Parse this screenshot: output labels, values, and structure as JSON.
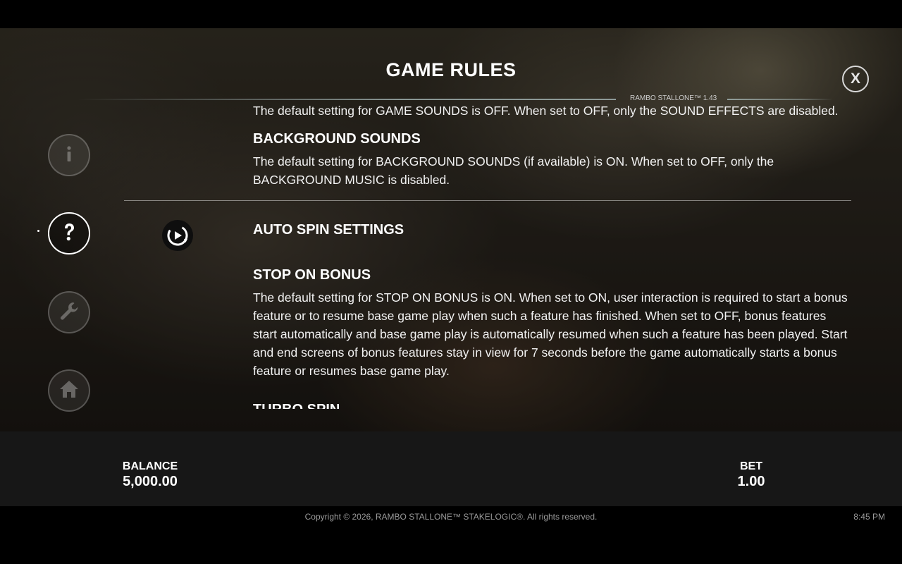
{
  "header": {
    "title": "GAME RULES",
    "version": "RAMBO STALLONE™ 1.43",
    "close_label": "X"
  },
  "nav": {
    "items": [
      {
        "name": "info",
        "icon": "info-icon",
        "active": false
      },
      {
        "name": "help",
        "icon": "question-icon",
        "active": true
      },
      {
        "name": "settings",
        "icon": "wrench-icon",
        "active": false
      },
      {
        "name": "home",
        "icon": "home-icon",
        "active": false
      }
    ]
  },
  "content": {
    "game_sounds_text": "The default setting for GAME SOUNDS is OFF. When set to OFF, only the SOUND EFFECTS are disabled.",
    "background_sounds_heading": "BACKGROUND SOUNDS",
    "background_sounds_text": "The default setting for BACKGROUND SOUNDS (if available) is ON. When set to OFF, only the BACKGROUND MUSIC is disabled.",
    "auto_spin_heading": "AUTO SPIN SETTINGS",
    "auto_spin_icon": "autospin-icon",
    "stop_on_bonus_heading": "STOP ON BONUS",
    "stop_on_bonus_text": "The default setting for STOP ON BONUS is ON. When set to ON, user interaction is required to start a bonus feature or to resume base game play when such a feature has finished. When set to OFF, bonus features start automatically and base game play is automatically resumed when such a feature has been played. Start and end screens of bonus features stay in view for 7 seconds before the game automatically starts a bonus feature or resumes base game play.",
    "turbo_spin_heading": "TURBO SPIN"
  },
  "bottom": {
    "balance_label": "BALANCE",
    "balance_value": "5,000.00",
    "bet_label": "BET",
    "bet_value": "1.00"
  },
  "footer": {
    "copyright": "Copyright © 2026, RAMBO STALLONE™ STAKELOGIC®. All rights reserved.",
    "time": "8:45 PM"
  }
}
